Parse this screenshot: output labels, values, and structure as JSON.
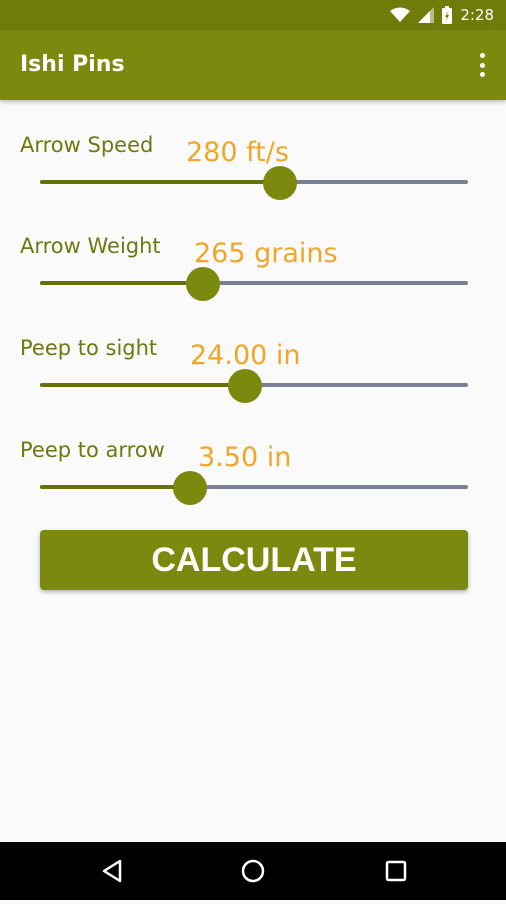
{
  "status": {
    "time": "2:28"
  },
  "app": {
    "title": "Ishi Pins"
  },
  "sliders": [
    {
      "label": "Arrow Speed",
      "value": "280 ft/s",
      "fraction": 0.56
    },
    {
      "label": "Arrow Weight",
      "value": "265 grains",
      "fraction": 0.38
    },
    {
      "label": "Peep to sight",
      "value": "24.00 in",
      "fraction": 0.48
    },
    {
      "label": "Peep to arrow",
      "value": "3.50 in",
      "fraction": 0.35
    }
  ],
  "actions": {
    "calculate_label": "CALCULATE"
  },
  "icons": [
    "wifi-icon",
    "signal-icon",
    "battery-icon",
    "overflow-menu-icon",
    "back-icon",
    "home-icon",
    "recents-icon"
  ]
}
